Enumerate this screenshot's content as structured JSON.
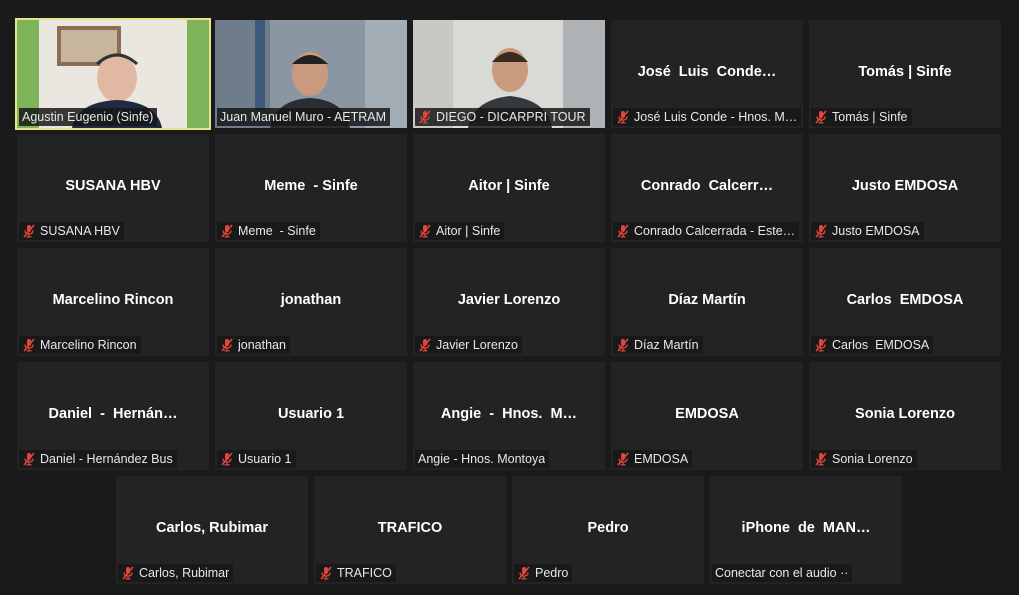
{
  "colors": {
    "background": "#1a1a1a",
    "tile": "#232323",
    "active_border": "#e8e48a",
    "muted_icon": "#e0463c"
  },
  "participants": [
    {
      "name": "Agustin Eugenio (Sinfe)",
      "label": "Agustin Eugenio (Sinfe)",
      "muted": false,
      "video": true,
      "active": true
    },
    {
      "name": "Juan Manuel Muro - AETRAM",
      "label": "Juan Manuel Muro - AETRAM",
      "muted": false,
      "video": true
    },
    {
      "name": "DIEGO - DICARPRI TOUR",
      "label": "DIEGO - DICARPRI TOUR",
      "muted": true,
      "video": true
    },
    {
      "name": "José  Luis  Conde…",
      "label": "José Luis Conde - Hnos. M…",
      "muted": true,
      "video": false
    },
    {
      "name": "Tomás | Sinfe",
      "label": "Tomás | Sinfe",
      "muted": true,
      "video": false
    },
    {
      "name": "SUSANA HBV",
      "label": "SUSANA HBV",
      "muted": true,
      "video": false
    },
    {
      "name": "Meme  - Sinfe",
      "label": "Meme  - Sinfe",
      "muted": true,
      "video": false
    },
    {
      "name": "Aitor | Sinfe",
      "label": "Aitor | Sinfe",
      "muted": true,
      "video": false
    },
    {
      "name": "Conrado  Calcerr…",
      "label": "Conrado Calcerrada - Este…",
      "muted": true,
      "video": false
    },
    {
      "name": "Justo EMDOSA",
      "label": "Justo EMDOSA",
      "muted": true,
      "video": false
    },
    {
      "name": "Marcelino Rincon",
      "label": "Marcelino Rincon",
      "muted": true,
      "video": false
    },
    {
      "name": "jonathan",
      "label": "jonathan",
      "muted": true,
      "video": false
    },
    {
      "name": "Javier Lorenzo",
      "label": "Javier Lorenzo",
      "muted": true,
      "video": false
    },
    {
      "name": "Díaz Martín",
      "label": "Díaz Martín",
      "muted": true,
      "video": false
    },
    {
      "name": "Carlos  EMDOSA",
      "label": "Carlos  EMDOSA",
      "muted": true,
      "video": false
    },
    {
      "name": "Daniel  -  Hernán…",
      "label": "Daniel - Hernández Bus",
      "muted": true,
      "video": false
    },
    {
      "name": "Usuario 1",
      "label": "Usuario 1",
      "muted": true,
      "video": false
    },
    {
      "name": "Angie  -  Hnos.  M…",
      "label": "Angie - Hnos. Montoya",
      "muted": false,
      "video": false
    },
    {
      "name": "EMDOSA",
      "label": "EMDOSA",
      "muted": true,
      "video": false
    },
    {
      "name": "Sonia Lorenzo",
      "label": "Sonia Lorenzo",
      "muted": true,
      "video": false
    },
    {
      "name": "Carlos, Rubimar",
      "label": "Carlos, Rubimar",
      "muted": true,
      "video": false
    },
    {
      "name": "TRAFICO",
      "label": "TRAFICO",
      "muted": true,
      "video": false
    },
    {
      "name": "Pedro",
      "label": "Pedro",
      "muted": true,
      "video": false
    },
    {
      "name": "iPhone  de  MAN…",
      "label": "Conectar con el audio ··",
      "muted": false,
      "video": false
    }
  ]
}
